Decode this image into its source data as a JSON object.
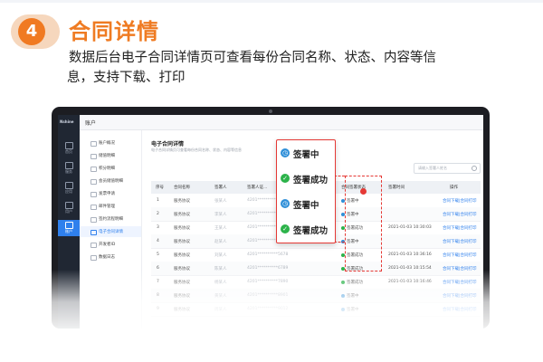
{
  "step": {
    "number": "4"
  },
  "title": "合同详情",
  "description": {
    "line1": "数据后台电子合同详情页可查看每份合同名称、状态、内容等信",
    "line2": "息，支持下载、打印"
  },
  "screen": {
    "rail": {
      "logo": "Nshine",
      "items": [
        {
          "label": "首页"
        },
        {
          "label": "服务"
        },
        {
          "label": "应用"
        },
        {
          "label": "用户"
        },
        {
          "label": "账户"
        }
      ]
    },
    "appbar_title": "账户",
    "sidebar": {
      "items": [
        {
          "label": "账户概况"
        },
        {
          "label": "储值明细"
        },
        {
          "label": "积分明细"
        },
        {
          "label": "会员储值明细"
        },
        {
          "label": "发票申请"
        },
        {
          "label": "邮件管理"
        },
        {
          "label": "签约流程明细"
        },
        {
          "label": "电子合同详情"
        },
        {
          "label": "开发者ID"
        },
        {
          "label": "数据日志"
        }
      ]
    },
    "main": {
      "title": "电子合同详情",
      "subtitle": "电子合同详情页可查看每份合同名称、状态、内容等信息",
      "search_placeholder": "请输入签署人姓名",
      "columns": [
        "序号",
        "合同名称",
        "签署人",
        "签署人证...",
        "",
        "合同签署状态",
        "签署时间",
        "操作"
      ],
      "rows": [
        {
          "no": "1",
          "name": "服务协议",
          "signer": "张某人",
          "id": "4201**********1234",
          "status": "签署中",
          "time": "",
          "action": "合同下载|合同打印"
        },
        {
          "no": "2",
          "name": "服务协议",
          "signer": "李某人",
          "id": "4201**********2345",
          "status": "签署中",
          "time": "",
          "action": "合同下载|合同打印"
        },
        {
          "no": "3",
          "name": "服务协议",
          "signer": "王某人",
          "id": "4201**********3456",
          "status": "签署成功",
          "time": "2021-01-03 10:30:03",
          "action": "合同下载|合同打印"
        },
        {
          "no": "4",
          "name": "服务协议",
          "signer": "赵某人",
          "id": "4201**********4567",
          "status": "签署中",
          "time": "",
          "action": "合同下载|合同打印"
        },
        {
          "no": "5",
          "name": "服务协议",
          "signer": "刘某人",
          "id": "4201**********5678",
          "status": "签署成功",
          "time": "2021-01-03 10:36:16",
          "action": "合同下载|合同打印"
        },
        {
          "no": "6",
          "name": "服务协议",
          "signer": "陈某人",
          "id": "4201**********6789",
          "status": "签署成功",
          "time": "2021-01-03 10:15:54",
          "action": "合同下载|合同打印"
        },
        {
          "no": "7",
          "name": "服务协议",
          "signer": "杨某人",
          "id": "4201**********7890",
          "status": "签署成功",
          "time": "2021-01-03 10:16:46",
          "action": "合同下载|合同打印"
        },
        {
          "no": "8",
          "name": "服务协议",
          "signer": "黄某人",
          "id": "4201**********8901",
          "status": "签署中",
          "time": "",
          "action": "合同下载|合同打印"
        },
        {
          "no": "9",
          "name": "服务协议",
          "signer": "周某人",
          "id": "4201**********9012",
          "status": "签署中",
          "time": "",
          "action": "合同下载|合同打印"
        }
      ]
    }
  },
  "callout": {
    "items": [
      {
        "label": "签署中",
        "kind": "signing",
        "color": "#2f8fd8"
      },
      {
        "label": "签署成功",
        "kind": "success",
        "color": "#2cb34a"
      },
      {
        "label": "签署中",
        "kind": "signing",
        "color": "#2f8fd8"
      },
      {
        "label": "签署成功",
        "kind": "success",
        "color": "#2cb34a"
      }
    ]
  },
  "colors": {
    "accent": "#f07a22",
    "highlight": "#e53935",
    "primary": "#2f80ed"
  }
}
